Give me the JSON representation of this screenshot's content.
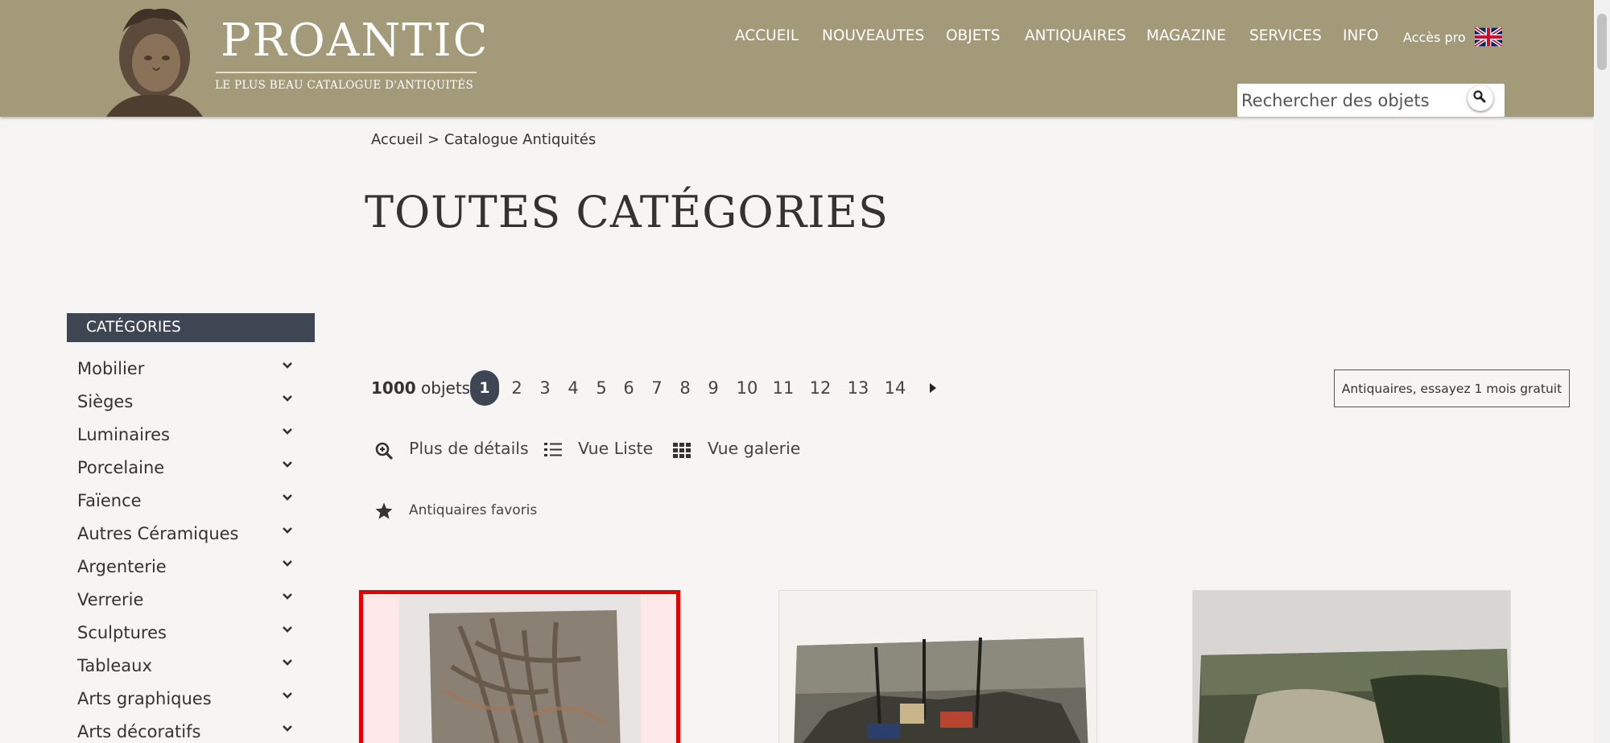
{
  "header": {
    "brand": "PROANTIC",
    "tagline": "LE PLUS BEAU CATALOGUE D'ANTIQUITÉS",
    "nav": [
      {
        "label": "ACCUEIL"
      },
      {
        "label": "NOUVEAUTES"
      },
      {
        "label": "OBJETS"
      },
      {
        "label": "ANTIQUAIRES"
      },
      {
        "label": "MAGAZINE"
      },
      {
        "label": "SERVICES"
      },
      {
        "label": "INFO"
      }
    ],
    "pro_label": "Accès pro",
    "language_flag": "uk-flag-icon",
    "search_placeholder": "Rechercher des objets",
    "colors": {
      "header_bg": "#a29a79",
      "dark_accent": "#3f4653",
      "highlight": "#e30000"
    }
  },
  "breadcrumb": {
    "home": "Accueil",
    "separator": ">",
    "current": "Catalogue Antiquités"
  },
  "page_title": "TOUTES CATÉGORIES",
  "sidebar": {
    "header": "CATÉGORIES",
    "items": [
      {
        "label": "Mobilier"
      },
      {
        "label": "Sièges"
      },
      {
        "label": "Luminaires"
      },
      {
        "label": "Porcelaine"
      },
      {
        "label": "Faïence"
      },
      {
        "label": "Autres Céramiques"
      },
      {
        "label": "Argenterie"
      },
      {
        "label": "Verrerie"
      },
      {
        "label": "Sculptures"
      },
      {
        "label": "Tableaux"
      },
      {
        "label": "Arts graphiques"
      },
      {
        "label": "Arts décoratifs"
      }
    ]
  },
  "results": {
    "count": "1000",
    "count_suffix": "objets",
    "pages": [
      "1",
      "2",
      "3",
      "4",
      "5",
      "6",
      "7",
      "8",
      "9",
      "10",
      "11",
      "12",
      "13",
      "14"
    ],
    "current_page": "1",
    "trial_button": "Antiquaires, essayez 1 mois gratuit"
  },
  "views": {
    "details": "Plus de détails",
    "list": "Vue Liste",
    "gallery": "Vue galerie",
    "favorites": "Antiquaires favoris"
  },
  "products": [
    {
      "image": "abstract-painting-thumbnail"
    },
    {
      "image": "harbor-painting-thumbnail"
    },
    {
      "image": "cliff-landscape-painting-thumbnail"
    }
  ]
}
